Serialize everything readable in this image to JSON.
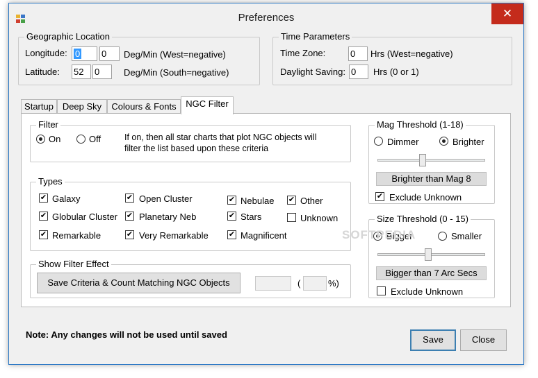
{
  "window": {
    "title": "Preferences",
    "close_glyph": "✕"
  },
  "geo": {
    "legend": "Geographic Location",
    "longitude_label": "Longitude:",
    "longitude_deg": "0",
    "longitude_min": "0",
    "longitude_hint": "Deg/Min (West=negative)",
    "latitude_label": "Latitude:",
    "latitude_deg": "52",
    "latitude_min": "0",
    "latitude_hint": "Deg/Min (South=negative)"
  },
  "time": {
    "legend": "Time Parameters",
    "zone_label": "Time Zone:",
    "zone_value": "0",
    "zone_hint": "Hrs (West=negative)",
    "dst_label": "Daylight Saving:",
    "dst_value": "0",
    "dst_hint": "Hrs (0 or 1)"
  },
  "tabs": [
    "Startup",
    "Deep Sky",
    "Colours & Fonts",
    "NGC Filter"
  ],
  "filter": {
    "legend": "Filter",
    "on_label": "On",
    "off_label": "Off",
    "description_line1": "If on, then all star charts that plot NGC objects will",
    "description_line2": "filter the list based upon these criteria"
  },
  "types": {
    "legend": "Types",
    "galaxy": "Galaxy",
    "globular_cluster": "Globular Cluster",
    "remarkable": "Remarkable",
    "open_cluster": "Open Cluster",
    "planetary_neb": "Planetary Neb",
    "very_remarkable": "Very Remarkable",
    "nebulae": "Nebulae",
    "stars": "Stars",
    "magnificent": "Magnificent",
    "other": "Other",
    "unknown": "Unknown"
  },
  "show_effect": {
    "legend": "Show Filter Effect",
    "button": "Save Criteria & Count Matching NGC Objects",
    "paren_open": "(",
    "paren_close": "%)"
  },
  "mag": {
    "legend": "Mag Threshold (1-18)",
    "dimmer": "Dimmer",
    "brighter": "Brighter",
    "readout": "Brighter than Mag 8",
    "exclude": "Exclude Unknown",
    "slider_value": 8
  },
  "size": {
    "legend": "Size Threshold (0 - 15)",
    "bigger": "Bigger",
    "smaller": "Smaller",
    "readout": "Bigger than 7 Arc Secs",
    "exclude": "Exclude Unknown",
    "slider_value": 7
  },
  "footer": {
    "note": "Note: Any changes will not be used until saved",
    "save": "Save",
    "close": "Close"
  },
  "watermark": "SOFTPEDIA",
  "check_mark": "✔",
  "colors": {
    "accent": "#2b78c5",
    "close_red": "#c42b1c",
    "selection": "#3399ff"
  }
}
